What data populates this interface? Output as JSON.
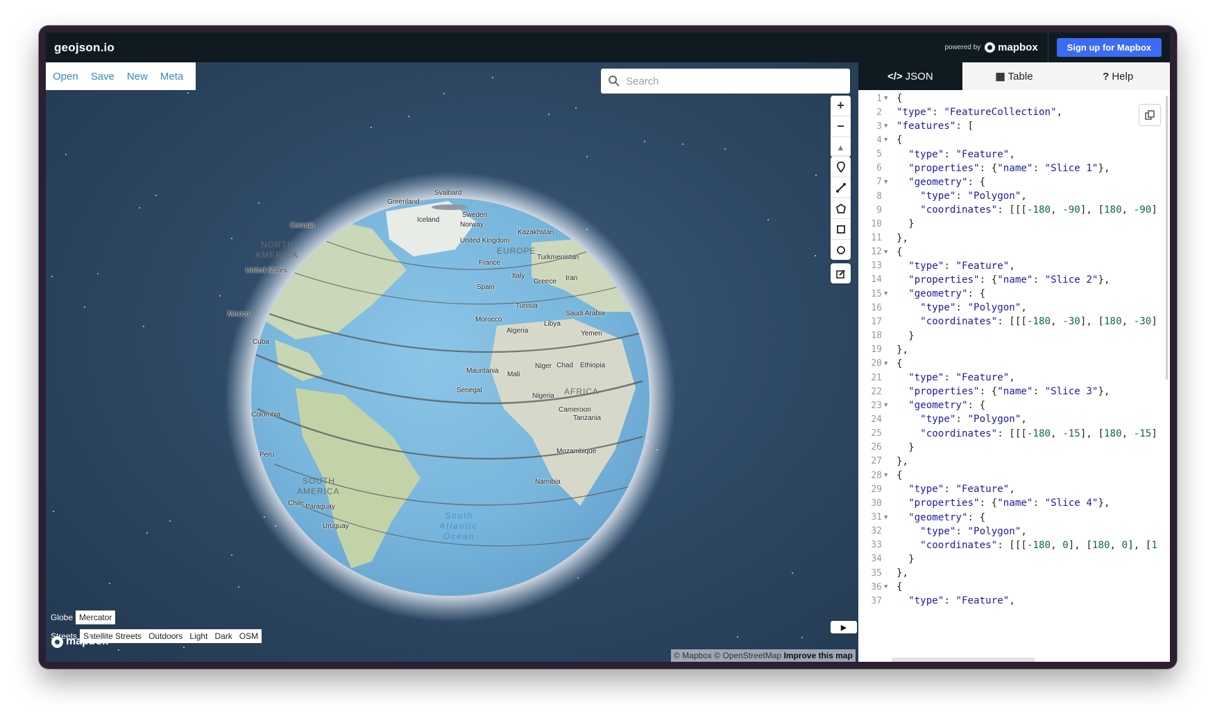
{
  "app": {
    "title": "geojson.io",
    "powered_by": "powered by",
    "mapbox_brand": "mapbox",
    "signup_label": "Sign up for Mapbox"
  },
  "map_menu": [
    "Open",
    "Save",
    "New",
    "Meta"
  ],
  "search": {
    "placeholder": "Search"
  },
  "map_controls": {
    "nav": [
      {
        "icon": "zoom-in-icon",
        "glyph": "+"
      },
      {
        "icon": "zoom-out-icon",
        "glyph": "−"
      },
      {
        "icon": "compass-icon",
        "glyph": "▲"
      }
    ],
    "draw": [
      {
        "icon": "marker-icon"
      },
      {
        "icon": "line-icon"
      },
      {
        "icon": "polygon-icon"
      },
      {
        "icon": "rectangle-icon"
      },
      {
        "icon": "circle-icon"
      }
    ],
    "edit": {
      "icon": "edit-icon"
    }
  },
  "projection": {
    "label": "Globe",
    "option": "Mercator"
  },
  "styles": {
    "label": "Streets",
    "options": [
      "Satellite Streets",
      "Outdoors",
      "Light",
      "Dark",
      "OSM"
    ]
  },
  "attribution": {
    "text": "© Mapbox © OpenStreetMap",
    "improve": "Improve this map"
  },
  "map_labels": [
    {
      "t": "Svalbard"
    },
    {
      "t": "Greenland"
    },
    {
      "t": "Sweden"
    },
    {
      "t": "Norway"
    },
    {
      "t": "Iceland"
    },
    {
      "t": "Canada"
    },
    {
      "t": "Kazakhstan"
    },
    {
      "t": "United Kingdom"
    },
    {
      "t": "EUROPE"
    },
    {
      "t": "NORTH"
    },
    {
      "t": "AMERICA"
    },
    {
      "t": "Turkmenistan"
    },
    {
      "t": "France"
    },
    {
      "t": "United States"
    },
    {
      "t": "Italy"
    },
    {
      "t": "Iran"
    },
    {
      "t": "Greece"
    },
    {
      "t": "Spain"
    },
    {
      "t": "Tunisia"
    },
    {
      "t": "Mexico"
    },
    {
      "t": "Saudi Arabia"
    },
    {
      "t": "Morocco"
    },
    {
      "t": "Libya"
    },
    {
      "t": "Algeria"
    },
    {
      "t": "Yemen"
    },
    {
      "t": "Cuba"
    },
    {
      "t": "Mauritania"
    },
    {
      "t": "Niger"
    },
    {
      "t": "Chad"
    },
    {
      "t": "Ethiopia"
    },
    {
      "t": "Mali"
    },
    {
      "t": "Senegal"
    },
    {
      "t": "AFRICA"
    },
    {
      "t": "Nigeria"
    },
    {
      "t": "Colombia"
    },
    {
      "t": "Cameroon"
    },
    {
      "t": "Tanzania"
    },
    {
      "t": "Mozambique"
    },
    {
      "t": "Peru"
    },
    {
      "t": "SOUTH"
    },
    {
      "t": "AMERICA"
    },
    {
      "t": "Namibia"
    },
    {
      "t": "Chile"
    },
    {
      "t": "Paraguay"
    },
    {
      "t": "South"
    },
    {
      "t": "Atlantic"
    },
    {
      "t": "Ocean"
    },
    {
      "t": "Uruguay"
    }
  ],
  "panel_tabs": [
    {
      "icon": "code-icon",
      "glyph": "</>",
      "label": "JSON"
    },
    {
      "icon": "table-icon",
      "glyph": "▦",
      "label": "Table"
    },
    {
      "icon": "help-icon",
      "glyph": "?",
      "label": "Help"
    }
  ],
  "code_lines": [
    {
      "n": "1",
      "f": "▼",
      "html": "{"
    },
    {
      "n": "2",
      "f": "",
      "html": "<span class='k'>\"type\"</span>: <span class='s'>\"FeatureCollection\"</span>,"
    },
    {
      "n": "3",
      "f": "▼",
      "html": "<span class='k'>\"features\"</span>: ["
    },
    {
      "n": "4",
      "f": "▼",
      "html": "{"
    },
    {
      "n": "5",
      "f": "",
      "html": "  <span class='k'>\"type\"</span>: <span class='s'>\"Feature\"</span>,"
    },
    {
      "n": "6",
      "f": "",
      "html": "  <span class='k'>\"properties\"</span>: {<span class='k'>\"name\"</span>: <span class='s'>\"Slice 1\"</span>},"
    },
    {
      "n": "7",
      "f": "▼",
      "html": "  <span class='k'>\"geometry\"</span>: {"
    },
    {
      "n": "8",
      "f": "",
      "html": "    <span class='k'>\"type\"</span>: <span class='s'>\"Polygon\"</span>,"
    },
    {
      "n": "9",
      "f": "",
      "html": "    <span class='k'>\"coordinates\"</span>: [[[<span class='n'>-180</span>, <span class='n'>-90</span>], [<span class='n'>180</span>, <span class='n'>-90</span>]"
    },
    {
      "n": "10",
      "f": "",
      "html": "  }"
    },
    {
      "n": "11",
      "f": "",
      "html": "},"
    },
    {
      "n": "12",
      "f": "▼",
      "html": "{"
    },
    {
      "n": "13",
      "f": "",
      "html": "  <span class='k'>\"type\"</span>: <span class='s'>\"Feature\"</span>,"
    },
    {
      "n": "14",
      "f": "",
      "html": "  <span class='k'>\"properties\"</span>: {<span class='k'>\"name\"</span>: <span class='s'>\"Slice 2\"</span>},"
    },
    {
      "n": "15",
      "f": "▼",
      "html": "  <span class='k'>\"geometry\"</span>: {"
    },
    {
      "n": "16",
      "f": "",
      "html": "    <span class='k'>\"type\"</span>: <span class='s'>\"Polygon\"</span>,"
    },
    {
      "n": "17",
      "f": "",
      "html": "    <span class='k'>\"coordinates\"</span>: [[[<span class='n'>-180</span>, <span class='n'>-30</span>], [<span class='n'>180</span>, <span class='n'>-30</span>]"
    },
    {
      "n": "18",
      "f": "",
      "html": "  }"
    },
    {
      "n": "19",
      "f": "",
      "html": "},"
    },
    {
      "n": "20",
      "f": "▼",
      "html": "{"
    },
    {
      "n": "21",
      "f": "",
      "html": "  <span class='k'>\"type\"</span>: <span class='s'>\"Feature\"</span>,"
    },
    {
      "n": "22",
      "f": "",
      "html": "  <span class='k'>\"properties\"</span>: {<span class='k'>\"name\"</span>: <span class='s'>\"Slice 3\"</span>},"
    },
    {
      "n": "23",
      "f": "▼",
      "html": "  <span class='k'>\"geometry\"</span>: {"
    },
    {
      "n": "24",
      "f": "",
      "html": "    <span class='k'>\"type\"</span>: <span class='s'>\"Polygon\"</span>,"
    },
    {
      "n": "25",
      "f": "",
      "html": "    <span class='k'>\"coordinates\"</span>: [[[<span class='n'>-180</span>, <span class='n'>-15</span>], [<span class='n'>180</span>, <span class='n'>-15</span>]"
    },
    {
      "n": "26",
      "f": "",
      "html": "  }"
    },
    {
      "n": "27",
      "f": "",
      "html": "},"
    },
    {
      "n": "28",
      "f": "▼",
      "html": "{"
    },
    {
      "n": "29",
      "f": "",
      "html": "  <span class='k'>\"type\"</span>: <span class='s'>\"Feature\"</span>,"
    },
    {
      "n": "30",
      "f": "",
      "html": "  <span class='k'>\"properties\"</span>: {<span class='k'>\"name\"</span>: <span class='s'>\"Slice 4\"</span>},"
    },
    {
      "n": "31",
      "f": "▼",
      "html": "  <span class='k'>\"geometry\"</span>: {"
    },
    {
      "n": "32",
      "f": "",
      "html": "    <span class='k'>\"type\"</span>: <span class='s'>\"Polygon\"</span>,"
    },
    {
      "n": "33",
      "f": "",
      "html": "    <span class='k'>\"coordinates\"</span>: [[[<span class='n'>-180</span>, <span class='n'>0</span>], [<span class='n'>180</span>, <span class='n'>0</span>], [<span class='n'>1</span>"
    },
    {
      "n": "34",
      "f": "",
      "html": "  }"
    },
    {
      "n": "35",
      "f": "",
      "html": "},"
    },
    {
      "n": "36",
      "f": "▼",
      "html": "{"
    },
    {
      "n": "37",
      "f": "",
      "html": "  <span class='k'>\"type\"</span>: <span class='s'>\"Feature\"</span>,"
    }
  ],
  "colors": {
    "topbar": "#0f1b21",
    "accent": "#3d6bf2",
    "link": "#3a88c6",
    "json_key": "#1a1aa6",
    "json_number": "#116644"
  }
}
